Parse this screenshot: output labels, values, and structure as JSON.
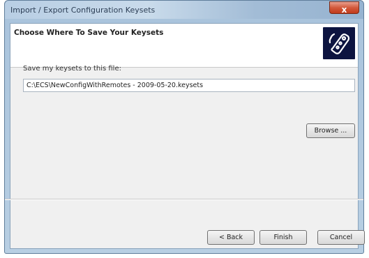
{
  "window": {
    "title": "Import / Export Configuration Keysets",
    "close_glyph": "x"
  },
  "header": {
    "title": "Choose Where To Save Your Keysets",
    "icon": "remote-control-icon"
  },
  "form": {
    "label": "Save my keysets to this file:",
    "path_value": "C:\\ECS\\NewConfigWithRemotes - 2009-05-20.keysets",
    "browse_label": "Browse ..."
  },
  "footer": {
    "back_label": "< Back",
    "finish_label": "Finish",
    "cancel_label": "Cancel"
  },
  "colors": {
    "header_icon_bg": "#0d1440",
    "close_button": "#c74a2c"
  }
}
